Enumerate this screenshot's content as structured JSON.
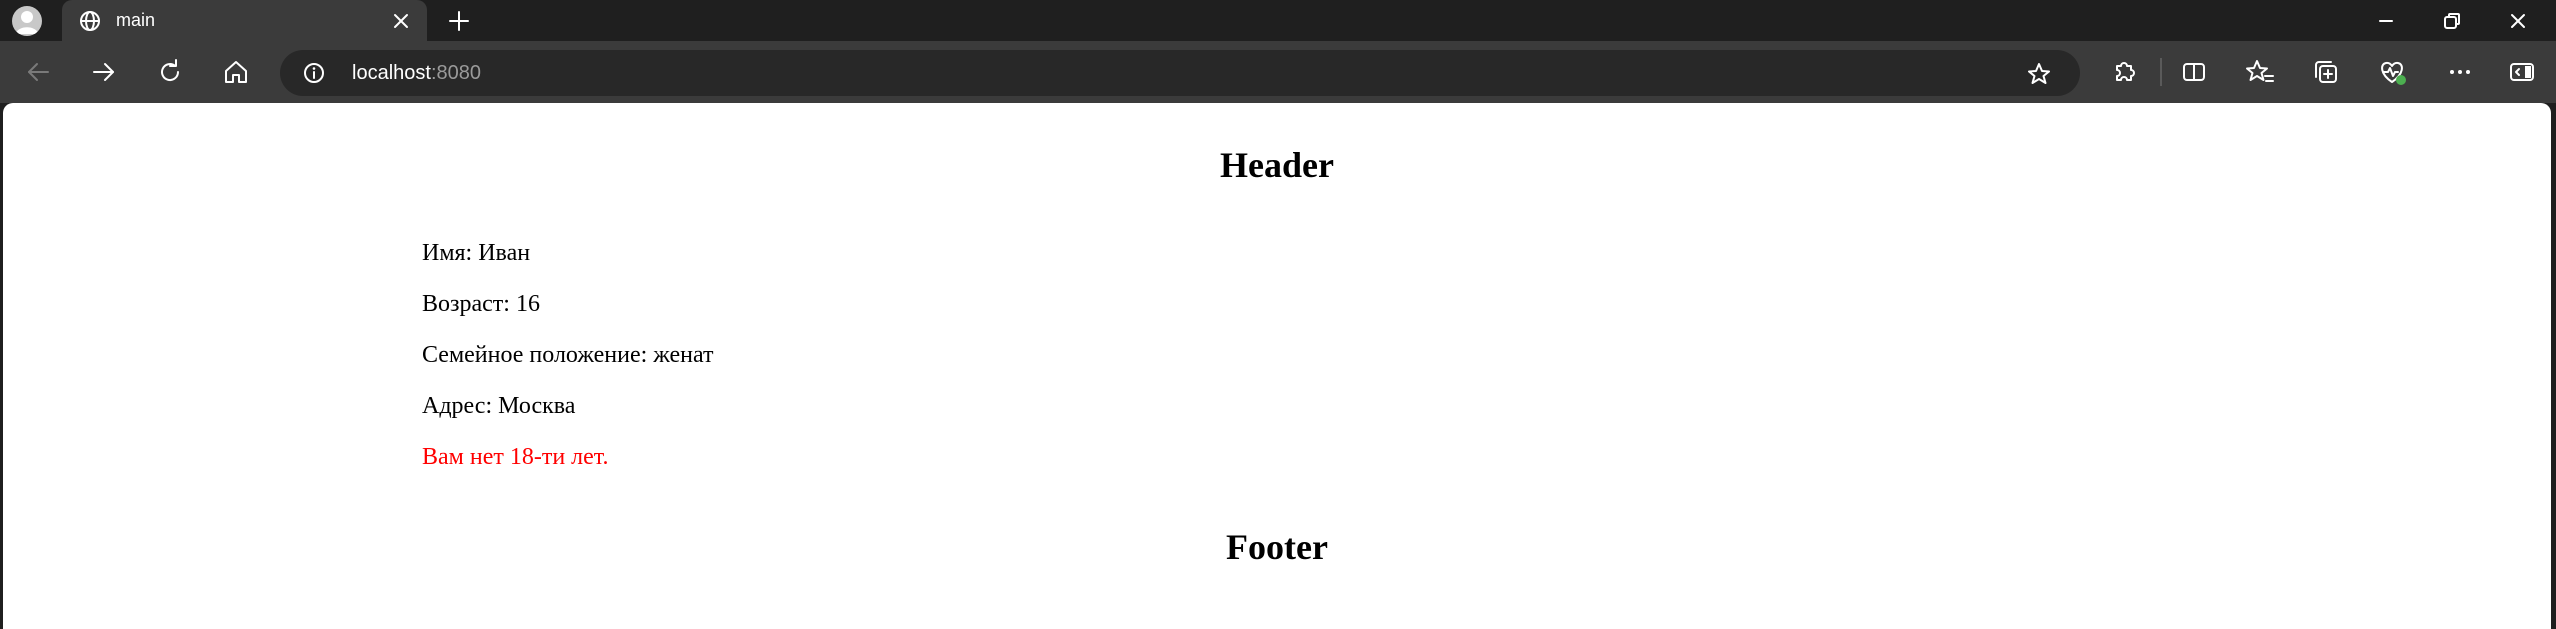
{
  "browser": {
    "tab": {
      "title": "main"
    },
    "address": {
      "host": "localhost",
      "port": ":8080"
    },
    "icons": {
      "profile": "profile-avatar-icon",
      "tab_favicon": "globe-icon",
      "tab_close": "close-icon",
      "new_tab": "plus-icon",
      "back": "back-arrow-icon",
      "forward": "forward-arrow-icon",
      "refresh": "refresh-icon",
      "home": "home-icon",
      "site_info": "info-icon",
      "favorite": "star-icon",
      "extensions": "puzzle-icon",
      "split_screen": "split-screen-icon",
      "favorites": "favorites-icon",
      "collections": "collections-icon",
      "browser_essentials": "heart-pulse-icon",
      "more": "more-icon",
      "sidebar": "sidebar-icon",
      "minimize": "minimize-icon",
      "restore": "restore-icon",
      "close_window": "close-icon"
    },
    "colors": {
      "chrome_bg": "#1f1f1f",
      "toolbar_bg": "#3b3b3b",
      "address_bg": "#282828",
      "health_badge": "#4caf50"
    }
  },
  "page": {
    "header": "Header",
    "fields": {
      "name": "Имя: Иван",
      "age": "Возраст: 16",
      "marital": "Семейное положение: женат",
      "address": "Адрес: Москва"
    },
    "warning": "Вам нет 18-ти лет.",
    "warning_color": "#ff0000",
    "footer": "Footer"
  }
}
